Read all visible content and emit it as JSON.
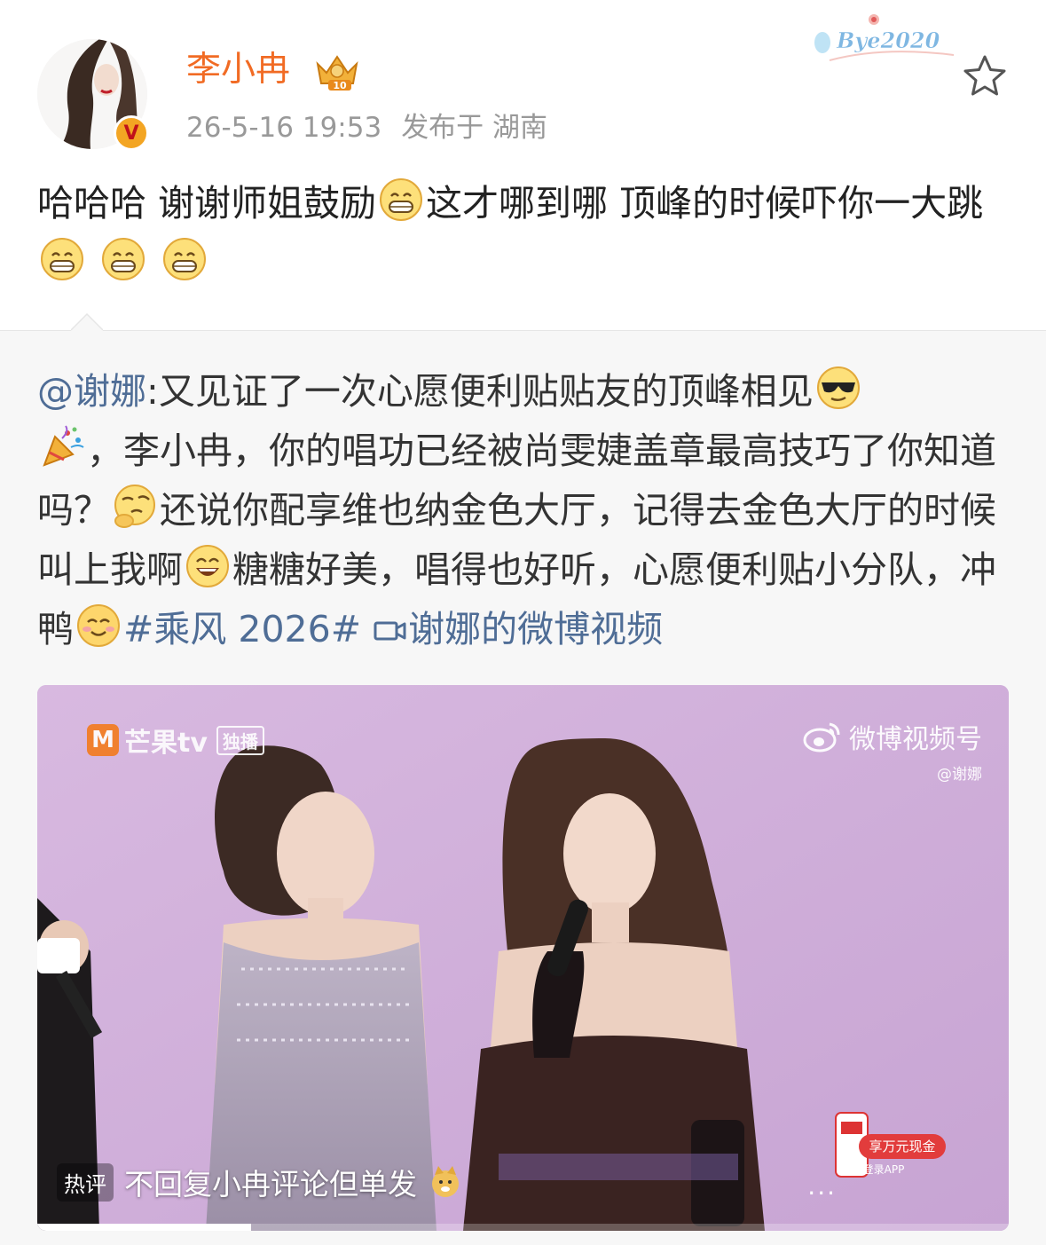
{
  "header": {
    "username": "李小冉",
    "timestamp": "26-5-16 19:53",
    "location": "发布于 湖南",
    "skin_text": "Bye2020",
    "crown_level": "10",
    "verified_badge": "V"
  },
  "post": {
    "segments": [
      "哈哈哈 谢谢师姐鼓励",
      "这才哪到哪 顶峰的时候吓你一大跳"
    ],
    "emoji_names": [
      "grin-emoji",
      "grin-emoji",
      "grin-emoji",
      "grin-emoji"
    ]
  },
  "repost": {
    "mention": "@谢娜",
    "text1": ":又见证了一次心愿便利贴贴友的顶峰相见",
    "text2": "，李小冉，你的唱功已经被尚雯婕盖章最高技巧了你知道吗？",
    "text3": "还说你配享维也纳金色大厅，记得去金色大厅的时候叫上我啊",
    "text4": "糖糖好美，唱得也好听，心愿便利贴小分队，冲鸭",
    "topic": "#乘风 2026#",
    "video_link": "谢娜的微博视频"
  },
  "video": {
    "watermark_left": "芒果tv",
    "watermark_left_tag": "独播",
    "watermark_right": "微博视频号",
    "watermark_handle": "@谢娜",
    "hot_label": "热评",
    "hot_comment": "不回复小冉评论但单发",
    "more": "...",
    "promo_text": "享万元现金",
    "promo_sub": "登录APP",
    "progress_fraction": 0.22
  },
  "colors": {
    "username": "#f16b24",
    "link": "#4f6d96",
    "meta": "#999999"
  }
}
